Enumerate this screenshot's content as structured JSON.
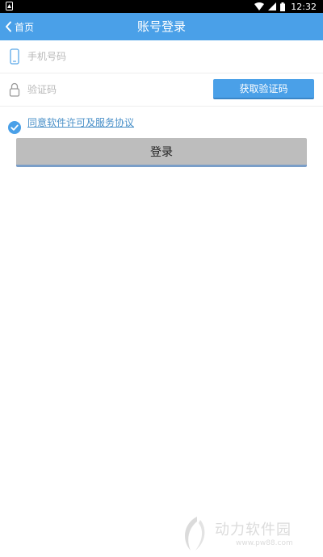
{
  "status_bar": {
    "time": "12:32",
    "icons": [
      "notification-icon",
      "wifi-icon",
      "signal-icon",
      "battery-icon"
    ]
  },
  "header": {
    "back_label": "首页",
    "title": "账号登录",
    "background_color": "#4aa0e8"
  },
  "form": {
    "phone": {
      "placeholder": "手机号码",
      "value": "",
      "icon": "phone-icon"
    },
    "code": {
      "placeholder": "验证码",
      "value": "",
      "icon": "lock-icon"
    },
    "get_code_label": "获取验证码",
    "agreement": {
      "checked": true,
      "label": "同意软件许可及服务协议"
    },
    "login_label": "登录"
  },
  "watermark": {
    "text": "动力软件园",
    "url": "www.pw88.com"
  },
  "colors": {
    "accent": "#4aa0e8",
    "link": "#4a90c8",
    "login_button": "#bdbdbd"
  }
}
